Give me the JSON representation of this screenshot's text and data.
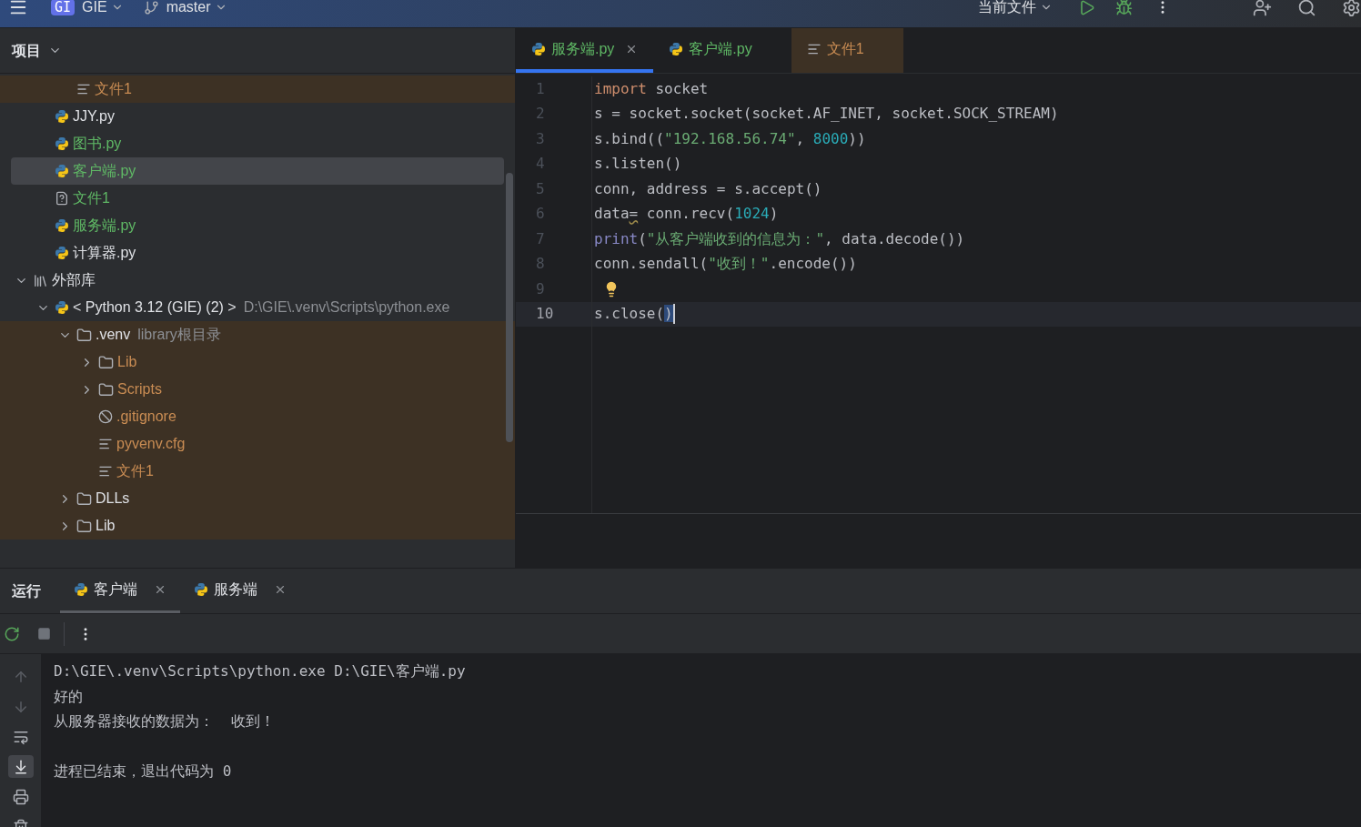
{
  "top_bar": {
    "project_badge": "GI",
    "project": "GIE",
    "branch": "master",
    "run_config": "当前文件"
  },
  "project_panel": {
    "title": "项目",
    "tree": [
      {
        "children": [
          {
            "children": [
              {
                "label": "文件1",
                "kind": "text",
                "color": "#c98c53",
                "excluded": true,
                "selected": false
              }
            ]
          },
          {
            "label": "JJY.py",
            "kind": "python",
            "color": "#dfe1e5",
            "excluded": false,
            "selected": false
          },
          {
            "label": "图书.py",
            "kind": "python",
            "color": "#5fb865",
            "excluded": false,
            "selected": false
          },
          {
            "label": "客户端.py",
            "kind": "python",
            "color": "#5fb865",
            "excluded": false,
            "selected": true
          },
          {
            "label": "文件1",
            "kind": "unknown",
            "color": "#5fb865",
            "excluded": false,
            "selected": false
          },
          {
            "label": "服务端.py",
            "kind": "python",
            "color": "#5fb865",
            "excluded": false,
            "selected": false
          },
          {
            "label": "计算器.py",
            "kind": "python",
            "color": "#dfe1e5",
            "excluded": false,
            "selected": false
          }
        ]
      },
      {
        "label": "外部库",
        "kind": "library",
        "color": "#dfe1e5",
        "excluded": false,
        "selected": false,
        "expanded": true,
        "children": [
          {
            "label": "< Python 3.12 (GIE) (2) >",
            "hint": "D:\\GIE\\.venv\\Scripts\\python.exe",
            "kind": "python",
            "color": "#dfe1e5",
            "excluded": false,
            "selected": false,
            "expanded": true,
            "children": [
              {
                "label": ".venv",
                "hint": "library根目录",
                "kind": "folder",
                "color": "#dfe1e5",
                "excluded": true,
                "selected": false,
                "expanded": true,
                "children": [
                  {
                    "label": "Lib",
                    "kind": "folder",
                    "color": "#c98c53",
                    "excluded": true,
                    "selected": false,
                    "expanded": false
                  },
                  {
                    "label": "Scripts",
                    "kind": "folder",
                    "color": "#c98c53",
                    "excluded": true,
                    "selected": false,
                    "expanded": false
                  },
                  {
                    "label": ".gitignore",
                    "kind": "ignore",
                    "color": "#c98c53",
                    "excluded": true,
                    "selected": false
                  },
                  {
                    "label": "pyvenv.cfg",
                    "kind": "text",
                    "color": "#c98c53",
                    "excluded": true,
                    "selected": false
                  },
                  {
                    "label": "文件1",
                    "kind": "text",
                    "color": "#c98c53",
                    "excluded": true,
                    "selected": false
                  }
                ]
              },
              {
                "label": "DLLs",
                "kind": "folder",
                "color": "#dfe1e5",
                "excluded": true,
                "selected": false,
                "expanded": false
              },
              {
                "label": "Lib",
                "kind": "folder",
                "color": "#dfe1e5",
                "excluded": true,
                "selected": false,
                "expanded": false
              }
            ]
          }
        ]
      }
    ]
  },
  "editor": {
    "tabs": [
      {
        "label": "服务端.py",
        "kind": "python",
        "color": "#5fb865",
        "selected": true,
        "closable": true,
        "excluded": false
      },
      {
        "label": "客户端.py",
        "kind": "python",
        "color": "#5fb865",
        "selected": false,
        "closable": false,
        "excluded": false
      },
      {
        "label": "文件1",
        "kind": "text",
        "color": "#c98c53",
        "selected": false,
        "closable": false,
        "excluded": true
      }
    ],
    "lines": [
      {
        "number": "1",
        "current": false,
        "kind": "code",
        "tokens": [
          {
            "kind": "keyword",
            "text": "import"
          },
          {
            "kind": "plain",
            "text": " socket"
          }
        ]
      },
      {
        "number": "2",
        "current": false,
        "kind": "code",
        "tokens": [
          {
            "kind": "plain",
            "text": "s = socket.socket(socket.AF_INET, socket.SOCK_STREAM)"
          }
        ]
      },
      {
        "number": "3",
        "current": false,
        "kind": "code",
        "tokens": [
          {
            "kind": "plain",
            "text": "s.bind(("
          },
          {
            "kind": "string",
            "text": "\"192.168.56.74\""
          },
          {
            "kind": "plain",
            "text": ", "
          },
          {
            "kind": "number",
            "text": "8000"
          },
          {
            "kind": "plain",
            "text": "))"
          }
        ]
      },
      {
        "number": "4",
        "current": false,
        "kind": "code",
        "tokens": [
          {
            "kind": "plain",
            "text": "s.listen()"
          }
        ]
      },
      {
        "number": "5",
        "current": false,
        "kind": "code",
        "tokens": [
          {
            "kind": "plain",
            "text": "conn, address = s.accept()"
          }
        ]
      },
      {
        "number": "6",
        "current": false,
        "kind": "code",
        "tokens": [
          {
            "kind": "plain",
            "text": "data"
          },
          {
            "kind": "warning",
            "text": "="
          },
          {
            "kind": "plain",
            "text": " conn.recv("
          },
          {
            "kind": "number",
            "text": "1024"
          },
          {
            "kind": "plain",
            "text": ")"
          }
        ]
      },
      {
        "number": "7",
        "current": false,
        "kind": "code",
        "tokens": [
          {
            "kind": "builtin",
            "text": "print"
          },
          {
            "kind": "plain",
            "text": "("
          },
          {
            "kind": "string",
            "text": "\"从客户端收到的信息为：\""
          },
          {
            "kind": "plain",
            "text": ", data.decode())"
          }
        ]
      },
      {
        "number": "8",
        "current": false,
        "kind": "code",
        "tokens": [
          {
            "kind": "plain",
            "text": "conn.sendall("
          },
          {
            "kind": "string",
            "text": "\"收到！\""
          },
          {
            "kind": "plain",
            "text": ".encode())"
          }
        ]
      },
      {
        "number": "9",
        "current": false,
        "kind": "bulb"
      },
      {
        "number": "10",
        "current": true,
        "kind": "code",
        "tokens": [
          {
            "kind": "plain",
            "text": "s.close("
          },
          {
            "kind": "match",
            "text": ")"
          }
        ]
      }
    ]
  },
  "run_panel": {
    "title": "运行",
    "tabs": [
      {
        "label": "客户端",
        "selected": true,
        "closable": true
      },
      {
        "label": "服务端",
        "selected": false,
        "closable": true
      }
    ],
    "side_tools": [
      {
        "kind": "up",
        "selected": false
      },
      {
        "kind": "down",
        "selected": false
      },
      {
        "kind": "wrap",
        "selected": false
      },
      {
        "kind": "scroll_end",
        "selected": true
      },
      {
        "kind": "print",
        "selected": false
      },
      {
        "kind": "delete",
        "selected": false
      }
    ],
    "console": [
      [
        "D:\\GIE\\.venv\\Scripts\\python.exe D:\\GIE\\客户端.py",
        "好的",
        "从服务器接收的数据为：  收到！"
      ],
      [
        "进程已结束，退出代码为 0"
      ]
    ]
  }
}
